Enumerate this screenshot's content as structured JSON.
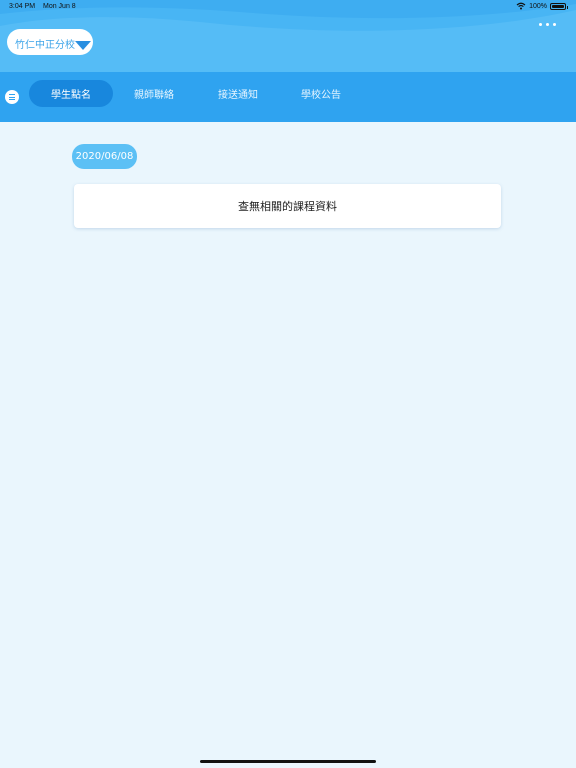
{
  "status_bar": {
    "time": "3:04 PM",
    "date": "Mon Jun 8",
    "battery": "100%"
  },
  "header": {
    "school_select": "竹仁中正分校"
  },
  "tabs": [
    {
      "label": "學生點名",
      "active": true
    },
    {
      "label": "親師聯絡",
      "active": false
    },
    {
      "label": "接送通知",
      "active": false
    },
    {
      "label": "學校公告",
      "active": false
    }
  ],
  "content": {
    "date": "2020/06/08",
    "empty_message": "查無相關的課程資料"
  },
  "colors": {
    "header": "#55bcf6",
    "tabbar": "#2fa3f0",
    "active_tab": "#1887dd",
    "badge": "#5cc0f5",
    "background": "#eaf6fd"
  },
  "icons": {
    "wifi": "wifi-icon",
    "battery": "battery-icon",
    "more": "more-icon",
    "menu": "menu-icon",
    "caret": "caret-down-icon"
  }
}
